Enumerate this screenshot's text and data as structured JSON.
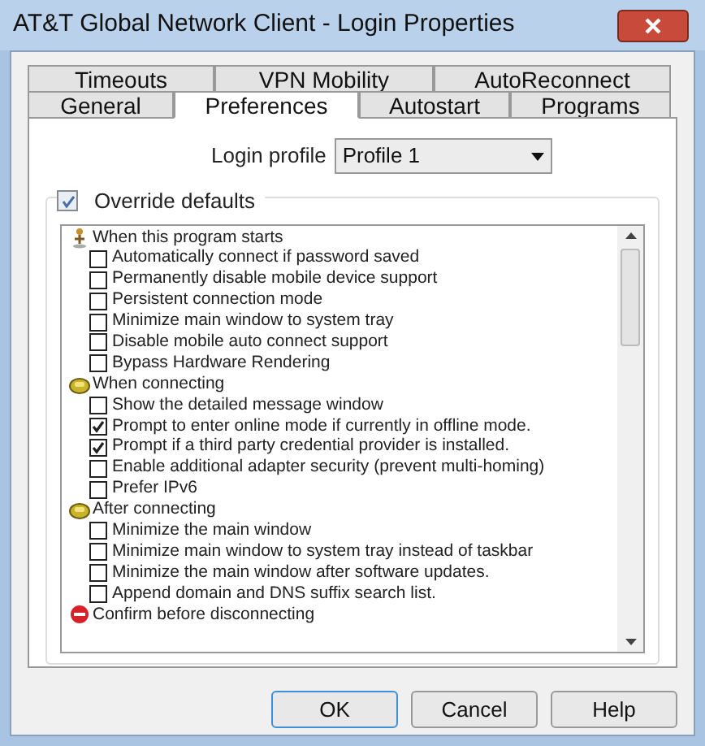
{
  "window": {
    "title": "AT&T Global Network Client - Login Properties"
  },
  "tab_rows": [
    [
      {
        "label": "Timeouts",
        "selected": false
      },
      {
        "label": "VPN Mobility",
        "selected": false
      },
      {
        "label": "AutoReconnect",
        "selected": false
      }
    ],
    [
      {
        "label": "General",
        "selected": false
      },
      {
        "label": "Preferences",
        "selected": true
      },
      {
        "label": "Autostart",
        "selected": false
      },
      {
        "label": "Programs",
        "selected": false
      }
    ]
  ],
  "login_profile": {
    "label": "Login profile",
    "value": "Profile 1"
  },
  "override": {
    "label": "Override defaults",
    "checked": true
  },
  "groups": [
    {
      "kind": "start",
      "title": "When this program starts",
      "items": [
        {
          "label": "Automatically connect if password saved",
          "checked": false
        },
        {
          "label": "Permanently disable mobile device support",
          "checked": false
        },
        {
          "label": "Persistent connection mode",
          "checked": false
        },
        {
          "label": "Minimize main window to system tray",
          "checked": false
        },
        {
          "label": "Disable mobile auto connect support",
          "checked": false
        },
        {
          "label": "Bypass Hardware Rendering",
          "checked": false
        }
      ]
    },
    {
      "kind": "connect",
      "title": "When connecting",
      "items": [
        {
          "label": "Show the detailed message window",
          "checked": false
        },
        {
          "label": "Prompt to enter online mode if currently in offline mode.",
          "checked": true
        },
        {
          "label": "Prompt if a third party credential provider is installed.",
          "checked": true
        },
        {
          "label": "Enable additional adapter security (prevent multi-homing)",
          "checked": false
        },
        {
          "label": "Prefer IPv6",
          "checked": false
        }
      ]
    },
    {
      "kind": "after",
      "title": "After connecting",
      "items": [
        {
          "label": "Minimize the main window",
          "checked": false
        },
        {
          "label": "Minimize main window to system tray instead of taskbar",
          "checked": false
        },
        {
          "label": "Minimize the main window after software updates.",
          "checked": false
        },
        {
          "label": "Append domain and DNS suffix search list.",
          "checked": false
        }
      ]
    },
    {
      "kind": "confirm",
      "title": "Confirm before disconnecting"
    }
  ],
  "buttons": [
    {
      "label": "OK",
      "default": true
    },
    {
      "label": "Cancel",
      "default": false
    },
    {
      "label": "Help",
      "default": false
    }
  ]
}
